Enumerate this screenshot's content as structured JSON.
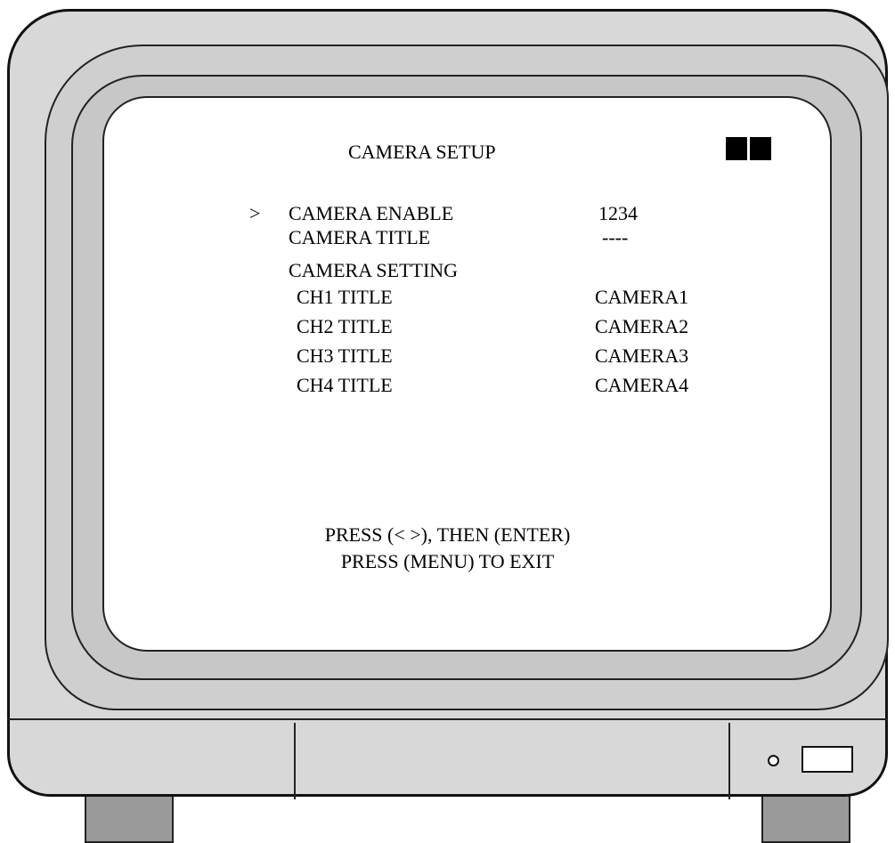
{
  "osd": {
    "title": "CAMERA SETUP",
    "cursor": ">",
    "menu_items": [
      {
        "label": "CAMERA ENABLE",
        "value": "1234"
      },
      {
        "label": "CAMERA TITLE",
        "value": "----"
      },
      {
        "label": "CAMERA SETTING",
        "value": ""
      },
      {
        "label": "CH1 TITLE",
        "value": "CAMERA1"
      },
      {
        "label": "CH2 TITLE",
        "value": "CAMERA2"
      },
      {
        "label": "CH3 TITLE",
        "value": "CAMERA3"
      },
      {
        "label": "CH4 TITLE",
        "value": "CAMERA4"
      }
    ],
    "hint_line1": "PRESS (< >), THEN (ENTER)",
    "hint_line2": "PRESS (MENU) TO EXIT"
  },
  "colors": {
    "screen": "#ffffff",
    "bezel": "#cfcfcf",
    "case": "#d8d8d8",
    "feet": "#9a9a9a",
    "text": "#000000"
  }
}
